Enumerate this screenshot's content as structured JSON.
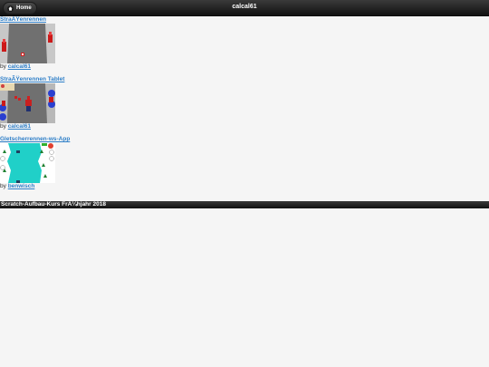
{
  "header": {
    "title": "calcal61",
    "home_label": "Home"
  },
  "projects": [
    {
      "title": "StraÃŸenrennen",
      "by": "by",
      "author": "calcal61"
    },
    {
      "title": "StraÃŸenrennen Tablet",
      "by": "by",
      "author": "calcal61"
    },
    {
      "title": "Gletscherrennen-ws-App",
      "by": "by",
      "author": "benwisch"
    }
  ],
  "footer": {
    "text": "Scratch-Aufbau-Kurs FrÃ¼hjahr 2018"
  },
  "colors": {
    "link": "#2f7fc8",
    "header_bg": "#1e1e1e",
    "page_bg": "#f5f5f5"
  }
}
